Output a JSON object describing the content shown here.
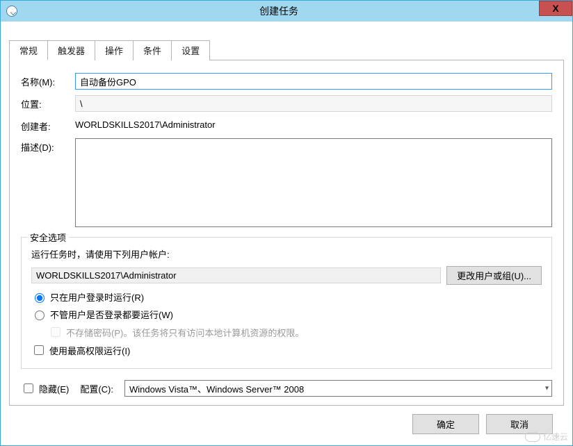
{
  "window": {
    "title": "创建任务",
    "close_glyph": "X"
  },
  "tabs": [
    {
      "label": "常规",
      "active": true
    },
    {
      "label": "触发器",
      "active": false
    },
    {
      "label": "操作",
      "active": false
    },
    {
      "label": "条件",
      "active": false
    },
    {
      "label": "设置",
      "active": false
    }
  ],
  "general": {
    "name_label": "名称(M):",
    "name_value": "自动备份GPO",
    "location_label": "位置:",
    "location_value": "\\",
    "author_label": "创建者:",
    "author_value": "WORLDSKILLS2017\\Administrator",
    "description_label": "描述(D):",
    "description_value": ""
  },
  "security": {
    "legend": "安全选项",
    "run_as_prompt": "运行任务时，请使用下列用户帐户:",
    "account": "WORLDSKILLS2017\\Administrator",
    "change_user_button": "更改用户或组(U)...",
    "radio_logged_on": "只在用户登录时运行(R)",
    "radio_any_time": "不管用户是否登录都要运行(W)",
    "chk_no_store_pw": "不存储密码(P)。该任务将只有访问本地计算机资源的权限。",
    "chk_highest_priv": "使用最高权限运行(I)",
    "radio_selected": "logged_on",
    "highest_priv_checked": false,
    "no_store_pw_checked": false
  },
  "bottom": {
    "hidden_label": "隐藏(E)",
    "hidden_checked": false,
    "configure_for_label": "配置(C):",
    "configure_for_value": "Windows Vista™、Windows Server™ 2008"
  },
  "footer": {
    "ok": "确定",
    "cancel": "取消"
  },
  "watermark": "亿速云"
}
